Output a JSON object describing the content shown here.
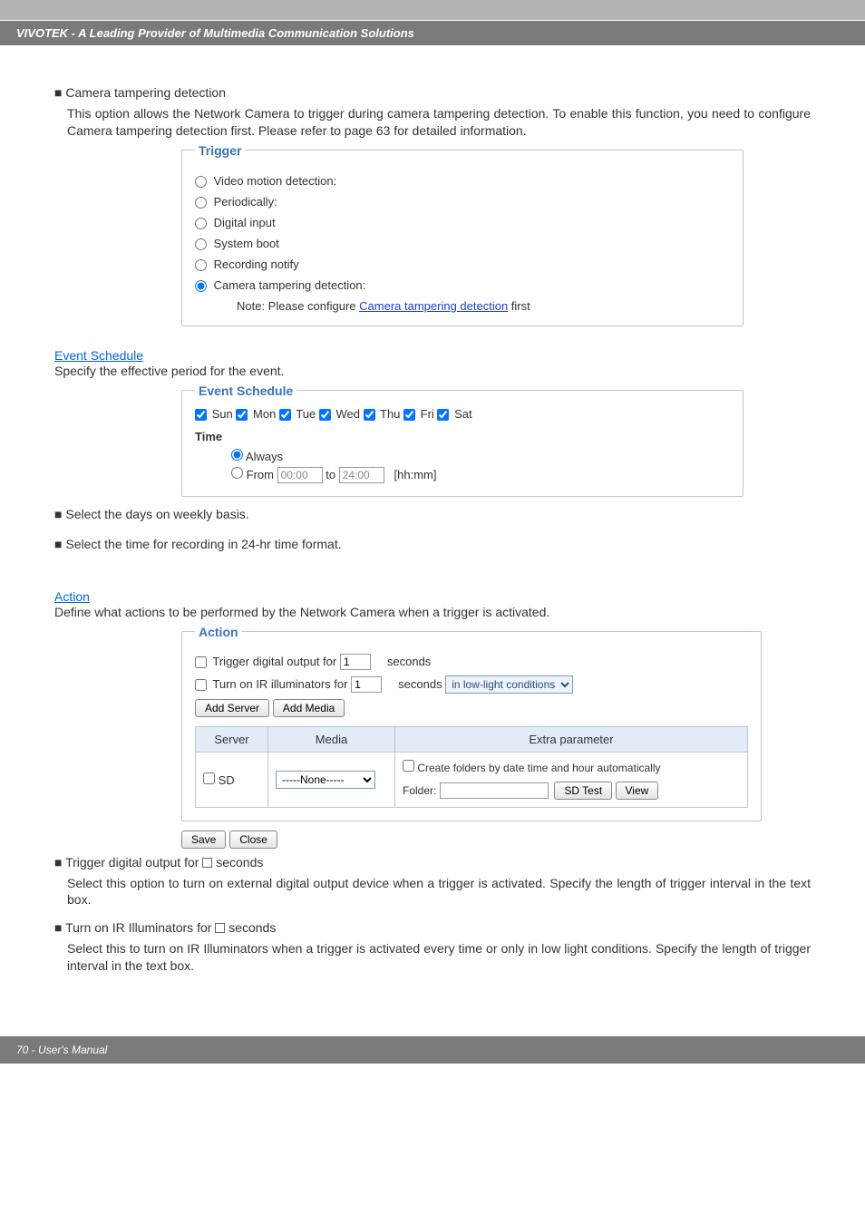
{
  "header": {
    "title": "VIVOTEK - A Leading Provider of Multimedia Communication Solutions"
  },
  "intro": {
    "bullet": "■",
    "title": "Camera tampering detection",
    "body": "This option allows the Network Camera to trigger during camera tampering detection. To enable this function, you need to configure Camera tampering detection first. Please refer to page 63 for detailed information."
  },
  "trigger": {
    "legend": "Trigger",
    "opts": [
      "Video motion detection:",
      "Periodically:",
      "Digital input",
      "System boot",
      "Recording notify",
      "Camera tampering detection:"
    ],
    "note_prefix": "Note: Please configure ",
    "note_link": "Camera tampering detection",
    "note_suffix": " first"
  },
  "schedule": {
    "heading": "Event Schedule",
    "caption": "Specify the effective period for the event.",
    "legend": "Event Schedule",
    "days": [
      "Sun",
      "Mon",
      "Tue",
      "Wed",
      "Thu",
      "Fri",
      "Sat"
    ],
    "time_label": "Time",
    "always": "Always",
    "from_label": "From",
    "from_val": "00:00",
    "to_label": "to",
    "to_val": "24:00",
    "hhmm": "[hh:mm]",
    "bullets": [
      "Select the days on weekly basis.",
      "Select the time for recording in 24-hr time format."
    ]
  },
  "action": {
    "heading": "Action",
    "caption": "Define what actions to be performed by the Network Camera when a trigger is activated.",
    "legend": "Action",
    "trig_out_label_a": "Trigger digital output for",
    "trig_out_val": "1",
    "seconds": "seconds",
    "ir_label": "Turn on IR illuminators for",
    "ir_val": "1",
    "ir_cond": "in low-light conditions",
    "add_server": "Add Server",
    "add_media": "Add Media",
    "th_server": "Server",
    "th_media": "Media",
    "th_extra": "Extra parameter",
    "sd": "SD",
    "none": "-----None-----",
    "create_folders": "Create folders by date time and hour automatically",
    "folder": "Folder:",
    "sd_test": "SD Test",
    "view": "View",
    "save": "Save",
    "close": "Close"
  },
  "post": {
    "t1_title": "Trigger digital output for ",
    "t1_suffix": " seconds",
    "t1_body": "Select this option to turn on external digital output device when a trigger is activated. Specify the length of trigger interval in the text box.",
    "t2_title": "Turn on IR Illuminators for ",
    "t2_suffix": " seconds",
    "t2_body": "Select this to turn on IR Illuminators when a trigger is activated every time or only in low light conditions. Specify the length of trigger interval in the text box."
  },
  "footer": {
    "text": "70 - User's Manual"
  }
}
